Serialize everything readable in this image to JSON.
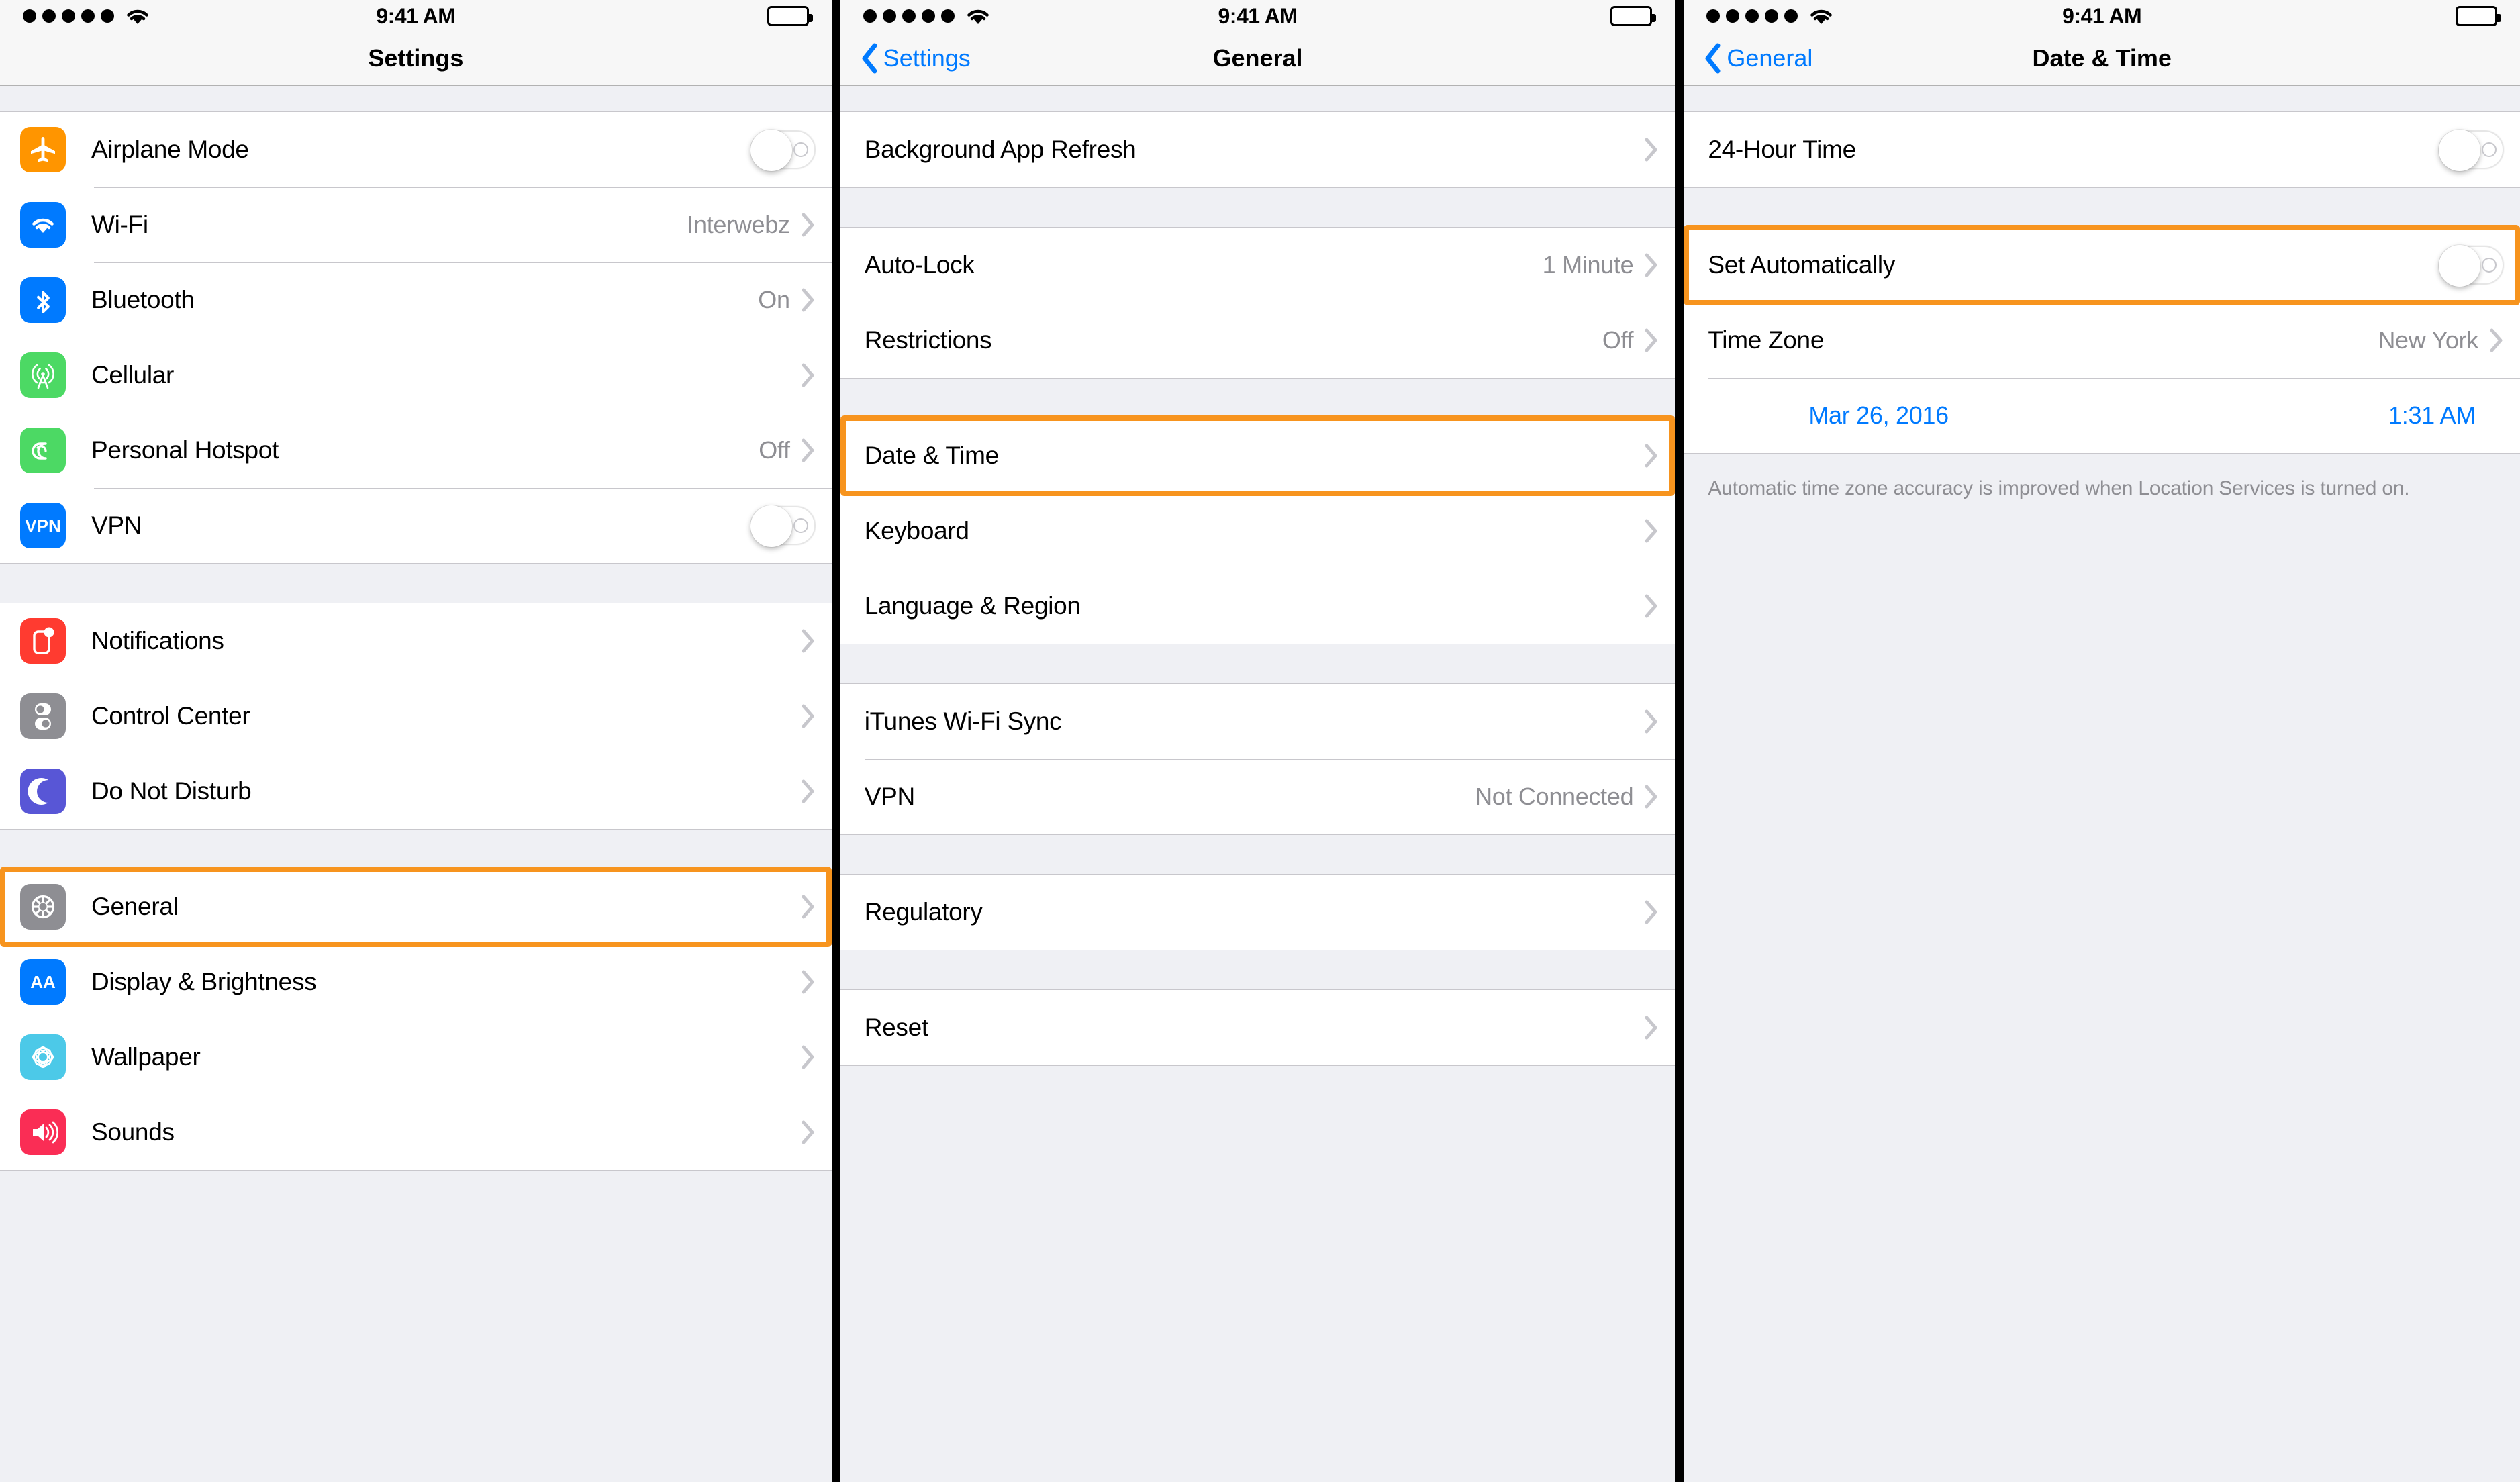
{
  "statusbar": {
    "time": "9:41 AM",
    "signal_dots": 5,
    "wifi": "wifi-icon",
    "battery": "battery-full-icon"
  },
  "panels": [
    {
      "id": "settings",
      "nav": {
        "title": "Settings",
        "back_label": null
      },
      "sections": [
        {
          "has_icons": true,
          "rows": [
            {
              "label": "Airplane Mode",
              "icon": "airplane-icon",
              "icon_color": "#ff9500",
              "accessory": "toggle",
              "toggle_on": false
            },
            {
              "label": "Wi-Fi",
              "icon": "wifi-icon",
              "icon_color": "#007aff",
              "detail": "Interwebz",
              "accessory": "chevron"
            },
            {
              "label": "Bluetooth",
              "icon": "bluetooth-icon",
              "icon_color": "#007aff",
              "detail": "On",
              "accessory": "chevron"
            },
            {
              "label": "Cellular",
              "icon": "cellular-tower-icon",
              "icon_color": "#4cd964",
              "accessory": "chevron"
            },
            {
              "label": "Personal Hotspot",
              "icon": "hotspot-link-icon",
              "icon_color": "#4cd964",
              "detail": "Off",
              "accessory": "chevron"
            },
            {
              "label": "VPN",
              "icon": "vpn-icon",
              "icon_color": "#007aff",
              "icon_text": "VPN",
              "accessory": "toggle",
              "toggle_on": false
            }
          ]
        },
        {
          "has_icons": true,
          "rows": [
            {
              "label": "Notifications",
              "icon": "notifications-icon",
              "icon_color": "#ff3b30",
              "accessory": "chevron"
            },
            {
              "label": "Control Center",
              "icon": "control-center-icon",
              "icon_color": "#8e8e93",
              "accessory": "chevron"
            },
            {
              "label": "Do Not Disturb",
              "icon": "moon-icon",
              "icon_color": "#5856d6",
              "accessory": "chevron"
            }
          ]
        },
        {
          "has_icons": true,
          "rows": [
            {
              "label": "General",
              "icon": "gear-icon",
              "icon_color": "#8e8e93",
              "accessory": "chevron",
              "highlighted": true
            },
            {
              "label": "Display & Brightness",
              "icon": "display-brightness-icon",
              "icon_color": "#007aff",
              "icon_text": "AA",
              "accessory": "chevron"
            },
            {
              "label": "Wallpaper",
              "icon": "wallpaper-flower-icon",
              "icon_color": "#4cc9e8",
              "accessory": "chevron"
            },
            {
              "label": "Sounds",
              "icon": "speaker-icon",
              "icon_color": "#fa2d55",
              "accessory": "chevron"
            }
          ]
        }
      ]
    },
    {
      "id": "general",
      "nav": {
        "title": "General",
        "back_label": "Settings"
      },
      "sections": [
        {
          "has_icons": false,
          "rows": [
            {
              "label": "Background App Refresh",
              "accessory": "chevron"
            }
          ]
        },
        {
          "has_icons": false,
          "rows": [
            {
              "label": "Auto-Lock",
              "detail": "1 Minute",
              "accessory": "chevron"
            },
            {
              "label": "Restrictions",
              "detail": "Off",
              "accessory": "chevron"
            }
          ]
        },
        {
          "has_icons": false,
          "rows": [
            {
              "label": "Date & Time",
              "accessory": "chevron",
              "highlighted": true
            },
            {
              "label": "Keyboard",
              "accessory": "chevron"
            },
            {
              "label": "Language & Region",
              "accessory": "chevron"
            }
          ]
        },
        {
          "has_icons": false,
          "rows": [
            {
              "label": "iTunes Wi-Fi Sync",
              "accessory": "chevron"
            },
            {
              "label": "VPN",
              "detail": "Not Connected",
              "accessory": "chevron"
            }
          ]
        },
        {
          "has_icons": false,
          "rows": [
            {
              "label": "Regulatory",
              "accessory": "chevron"
            }
          ]
        },
        {
          "has_icons": false,
          "rows": [
            {
              "label": "Reset",
              "accessory": "chevron"
            }
          ]
        }
      ]
    },
    {
      "id": "date-time",
      "nav": {
        "title": "Date & Time",
        "back_label": "General"
      },
      "sections": [
        {
          "has_icons": false,
          "rows": [
            {
              "label": "24-Hour Time",
              "accessory": "toggle",
              "toggle_on": false
            }
          ]
        },
        {
          "has_icons": false,
          "rows": [
            {
              "label": "Set Automatically",
              "accessory": "toggle",
              "toggle_on": false,
              "highlighted": true
            },
            {
              "label": "Time Zone",
              "detail": "New York",
              "accessory": "chevron"
            },
            {
              "label": "",
              "accessory": "datetime",
              "date": "Mar 26, 2016",
              "time": "1:31 AM"
            }
          ]
        }
      ],
      "footnote": "Automatic time zone accuracy is improved when Location Services is turned on."
    }
  ],
  "colors": {
    "highlight": "#f7941e",
    "link": "#007aff",
    "detail_text": "#8e8e93",
    "separator": "#c8c7cc",
    "group_bg": "#ffffff",
    "page_bg": "#eff0f4"
  }
}
